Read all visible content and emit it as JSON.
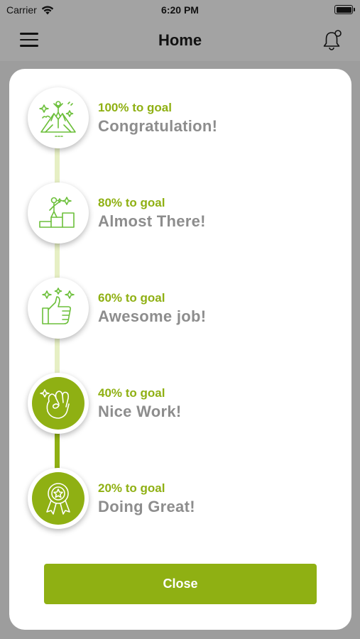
{
  "status_bar": {
    "carrier": "Carrier",
    "time": "6:20 PM"
  },
  "nav": {
    "title": "Home"
  },
  "colors": {
    "accent": "#8fb013",
    "accent_light": "#e6efc4",
    "text_gray": "#8d8d8d"
  },
  "steps": [
    {
      "progress": "100% to goal",
      "message": "Congratulation!",
      "icon": "mountain-summit-icon",
      "achieved": false
    },
    {
      "progress": "80% to goal",
      "message": "Almost There!",
      "icon": "climbing-steps-icon",
      "achieved": false
    },
    {
      "progress": "60% to goal",
      "message": "Awesome job!",
      "icon": "thumbs-up-stars-icon",
      "achieved": false
    },
    {
      "progress": "40% to goal",
      "message": "Nice Work!",
      "icon": "ok-hand-icon",
      "achieved": true
    },
    {
      "progress": "20% to goal",
      "message": "Doing Great!",
      "icon": "award-medal-icon",
      "achieved": true
    }
  ],
  "modal": {
    "close_label": "Close"
  }
}
